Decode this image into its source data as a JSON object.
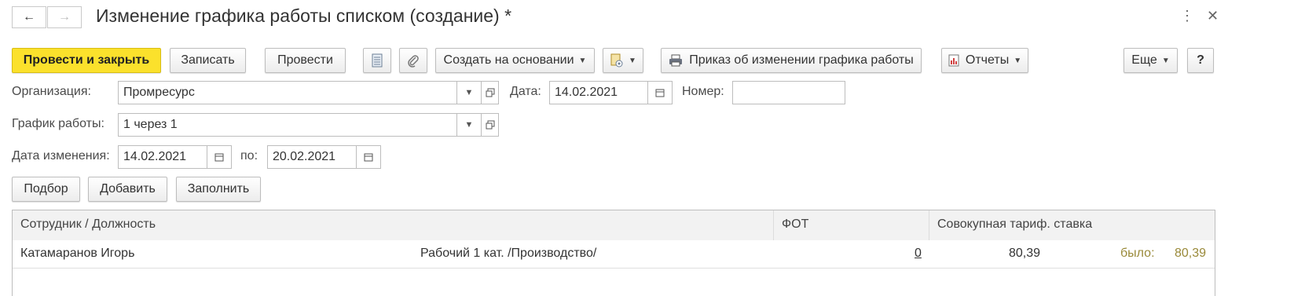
{
  "window": {
    "title": "Изменение графика работы списком (создание) *",
    "back_icon": "←",
    "forward_icon": "→",
    "more_icon": "⋮",
    "close_icon": "✕"
  },
  "toolbar": {
    "post_and_close": "Провести и закрыть",
    "save": "Записать",
    "post": "Провести",
    "create_based_on": "Создать на основании",
    "order_print": "Приказ об изменении графика работы",
    "reports": "Отчеты",
    "more": "Еще",
    "help": "?"
  },
  "form": {
    "organization_label": "Организация:",
    "organization_value": "Промресурс",
    "date_label": "Дата:",
    "date_value": "14.02.2021",
    "number_label": "Номер:",
    "number_value": "",
    "schedule_label": "График работы:",
    "schedule_value": "1 через 1",
    "change_date_label": "Дата изменения:",
    "change_date_from": "14.02.2021",
    "to_label": "по:",
    "change_date_to": "20.02.2021"
  },
  "table_toolbar": {
    "pick": "Подбор",
    "add": "Добавить",
    "fill": "Заполнить"
  },
  "table": {
    "columns": [
      "Сотрудник / Должность",
      "ФОТ",
      "Совокупная тариф. ставка"
    ],
    "rows": [
      {
        "employee": "Катамаранов Игорь",
        "position": "Рабочий 1 кат. /Производство/",
        "fot": "0",
        "rate": "80,39",
        "was_label": "было:",
        "was_value": "80,39"
      }
    ]
  },
  "colors": {
    "primary_button": "#fbe12c",
    "border": "#bdbdbd",
    "header_bg": "#f2f2f2",
    "was_label": "#9a8a3a"
  }
}
